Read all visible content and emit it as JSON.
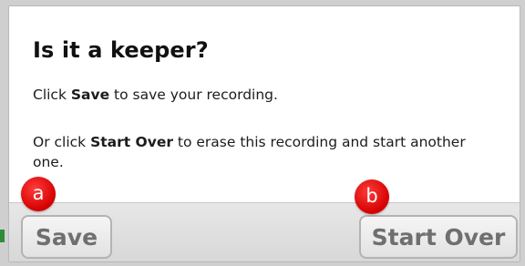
{
  "dialog": {
    "title": "Is it a keeper?",
    "line1": {
      "prefix": "Click ",
      "emphasis": "Save",
      "suffix": " to save your recording."
    },
    "line2": {
      "prefix": "Or click ",
      "emphasis": "Start Over",
      "suffix": " to erase this recording and start another one."
    }
  },
  "buttons": {
    "save_label": "Save",
    "start_over_label": "Start Over"
  },
  "callouts": {
    "a": "a",
    "b": "b"
  },
  "colors": {
    "badge": "#e00000",
    "button_text": "#6f6f6f",
    "footer_bg": "#dcdcdc"
  }
}
